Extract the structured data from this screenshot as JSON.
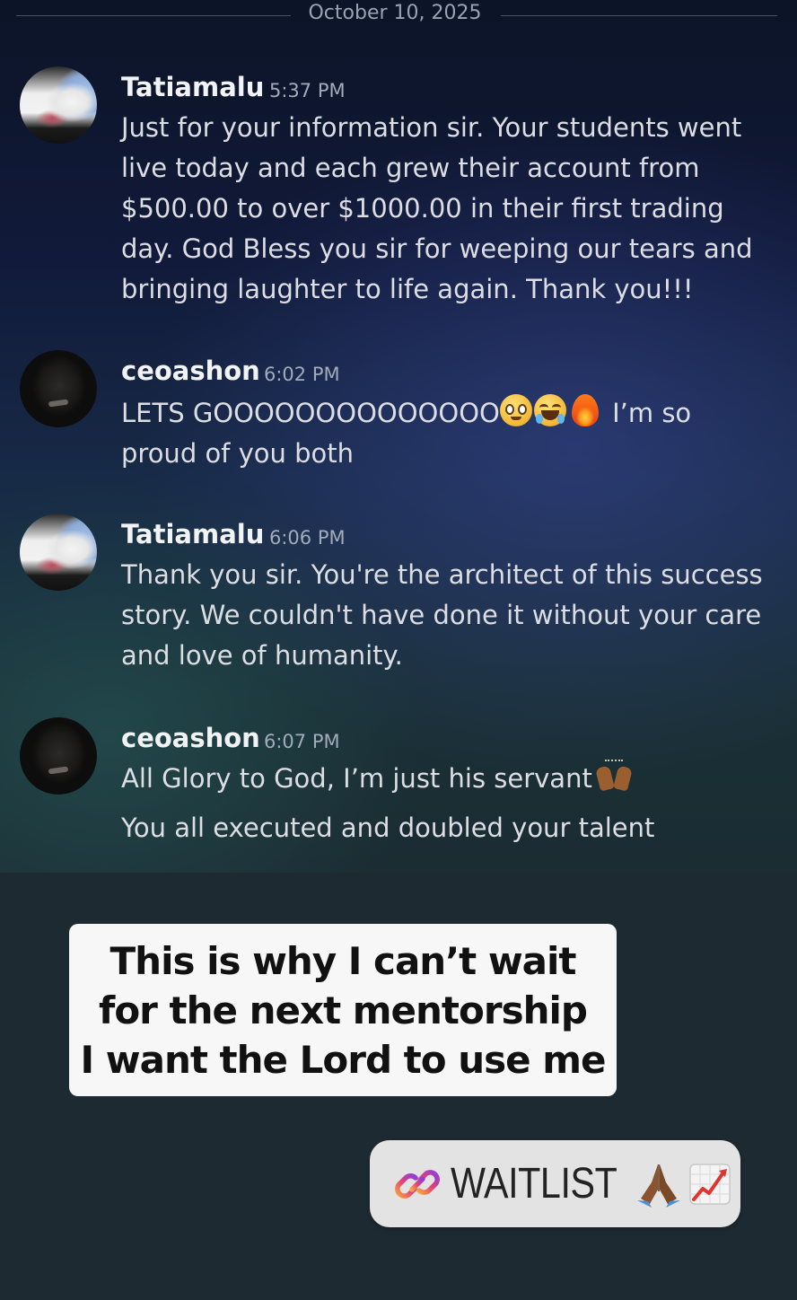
{
  "chat": {
    "date": "October 10, 2025",
    "messages": [
      {
        "author": "Tatiamalu",
        "time": "5:37 PM",
        "lines": [
          "Just for your information sir. Your students went",
          "live today and each grew their account from",
          "$500.00 to over $1000.00 in their first trading",
          "day. God Bless you sir for weeping our tears and",
          "bringing laughter to life again. Thank you!!!"
        ]
      },
      {
        "author": "ceoashon",
        "time": "6:02 PM",
        "text_main": "LETS GOOOOOOOOOOOOOO",
        "text_after_emoji": "I’m so",
        "line2": "proud of you both",
        "emojis": [
          "pleading-face",
          "tears-of-joy",
          "fire"
        ]
      },
      {
        "author": "Tatiamalu",
        "time": "6:06 PM",
        "lines": [
          "Thank you sir. You're the architect of this success",
          "story. We couldn't have done it without your care",
          "and love of humanity."
        ]
      },
      {
        "author": "ceoashon",
        "time": "6:07 PM",
        "line1": "All Glory to God, I’m just his servant",
        "line1_emoji": "raising-hands",
        "line2": "You all executed and doubled your talent"
      }
    ]
  },
  "banner": {
    "lines": [
      "This is why I can’t wait",
      "for the next mentorship",
      "I want the Lord to use me"
    ]
  },
  "link_sticker": {
    "label": "WAITLIST",
    "icons": [
      "link",
      "folded-hands",
      "chart-increasing"
    ]
  },
  "colors": {
    "chat_bg_top": "#0c1427",
    "chat_bg_bottom": "#1b2c33",
    "page_bg": "#1d2a31",
    "author": "#f2f3f5",
    "message_text": "#dcdee3",
    "timestamp": "#a3abb8",
    "banner_bg": "#f7f7f7",
    "sticker_bg": "#e3e3e3"
  }
}
